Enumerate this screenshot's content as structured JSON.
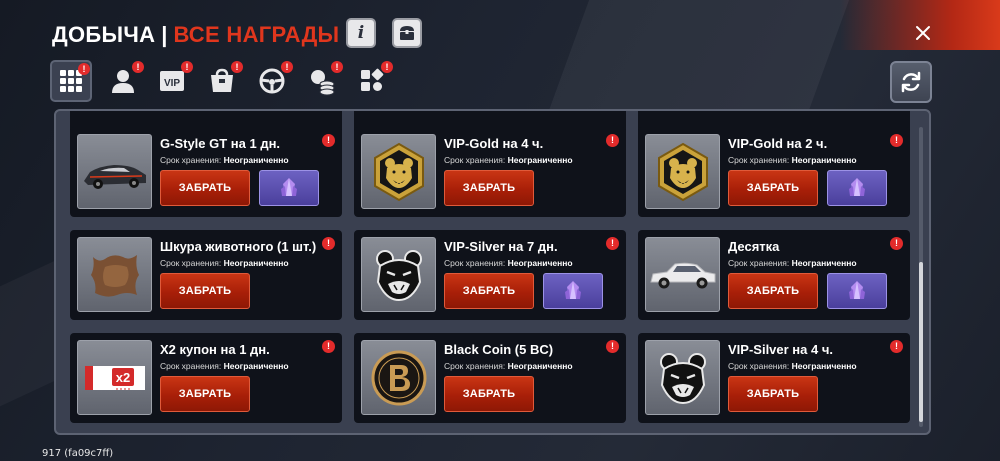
{
  "header": {
    "title_main": "ДОБЫЧА",
    "separator": "|",
    "title_accent": "ВСЕ НАГРАДЫ",
    "info_icon": "info-icon",
    "chest_icon": "chest-icon",
    "close_icon": "close-icon",
    "accent_color": "#e0361d"
  },
  "tabs": [
    {
      "icon": "grid-icon",
      "active": true,
      "badge": "!"
    },
    {
      "icon": "user-icon",
      "active": false,
      "badge": "!"
    },
    {
      "icon": "vip-icon",
      "label": "VIP",
      "active": false,
      "badge": "!"
    },
    {
      "icon": "bag-icon",
      "active": false,
      "badge": "!"
    },
    {
      "icon": "steering-wheel-icon",
      "active": false,
      "badge": "!"
    },
    {
      "icon": "coins-icon",
      "active": false,
      "badge": "!"
    },
    {
      "icon": "apps-icon",
      "active": false,
      "badge": "!"
    }
  ],
  "refresh_icon": "refresh-icon",
  "storage_label": "Срок хранения:",
  "storage_value": "Неограниченно",
  "claim_label": "ЗАБРАТЬ",
  "rewards": [
    {
      "title": "G-Style GT на 1 дн.",
      "icon": "sports-car-icon",
      "has_gem": true,
      "badge": "!"
    },
    {
      "title": "VIP-Gold на 4 ч.",
      "icon": "gold-bear-icon",
      "has_gem": false,
      "badge": "!"
    },
    {
      "title": "VIP-Gold на 2 ч.",
      "icon": "gold-bear-icon",
      "has_gem": true,
      "badge": "!"
    },
    {
      "title": "Шкура животного (1 шт.)",
      "icon": "animal-hide-icon",
      "has_gem": false,
      "badge": "!"
    },
    {
      "title": "VIP-Silver на 7 дн.",
      "icon": "silver-bear-icon",
      "has_gem": true,
      "badge": "!"
    },
    {
      "title": "Десятка",
      "icon": "sedan-car-icon",
      "has_gem": true,
      "badge": "!"
    },
    {
      "title": "X2 купон на 1 дн.",
      "icon": "coupon-icon",
      "coupon_text": "x2",
      "has_gem": false,
      "badge": "!"
    },
    {
      "title": "Black Coin (5 BC)",
      "icon": "black-coin-icon",
      "has_gem": false,
      "badge": "!"
    },
    {
      "title": "VIP-Silver на 4 ч.",
      "icon": "silver-bear-icon",
      "has_gem": false,
      "badge": "!"
    }
  ],
  "gem_icon": "crystal-icon",
  "build_id": "917 (fa09c7ff)"
}
